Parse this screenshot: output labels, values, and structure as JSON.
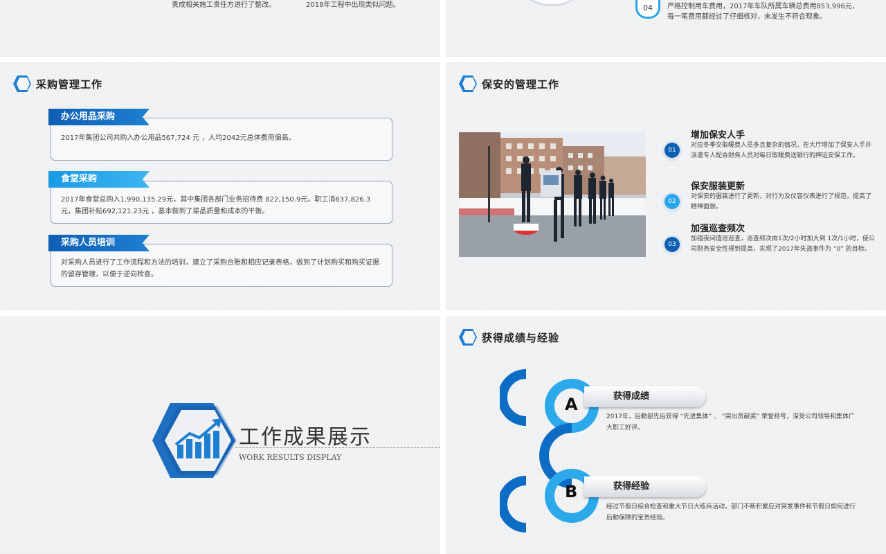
{
  "top_left": {
    "text_a": "责成相关施工责任方进行了整改。",
    "text_b": "2018年工程中出现类似问题。"
  },
  "top_right": {
    "num": "04",
    "line1": "严格控制用车费用，2017年车队所属车辆总费用853,996元，",
    "line2": "每一笔费用都经过了仔细核对，未发生不符合现象。"
  },
  "procurement": {
    "title": "采购管理工作",
    "items": [
      {
        "label": "办公用品采购",
        "text": "2017年集团公司共购入办公用品567,724  元 ，人均2042元总体费用偏高。"
      },
      {
        "label": "食堂采购",
        "text": "2017年食堂总购入1,990,135.29元，其中集团各部门业务招待费 822,150.9元。职工消637,826.3元，集团补贴692,121.23元  ，基本做到了菜品质量和成本的平衡。"
      },
      {
        "label": "采购人员培训",
        "text": "对采购人员进行了工作流程和方法的培训，建立了采购台账和相应记录表格，做到了计划购买和购买证据的留存管理，以便于逆向检查。"
      }
    ]
  },
  "security": {
    "title": "保安的管理工作",
    "items": [
      {
        "num": "01",
        "head": "增加保安人手",
        "body": "对应冬季交取暖费人员多且复杂的情况，在大厅增加了保安人手并派遣专人配合财务人员对每日取暖费送银行的押运安保工作。"
      },
      {
        "num": "02",
        "head": "保安服装更新",
        "body": "对保安的服装进行了更新，对行为及仪容仪表进行了规范，提高了精神面貌。"
      },
      {
        "num": "03",
        "head": "加强巡查频次",
        "body": "加强夜间值班巡查，巡查频次由1次/2小时加大到 1次/1小时，使公司财务安全性得到提高，实现了2017年失盗事件为 “0” 的目标。"
      }
    ]
  },
  "cover": {
    "title": "工作成果展示",
    "subtitle": "WORK RESULTS DISPLAY"
  },
  "results": {
    "title": "获得成绩与经验",
    "items": [
      {
        "letter": "A",
        "label": "获得成绩",
        "text": "2017年，后勤部先后获得 “先进集体” 、 “突出贡献奖” 荣誉称号，深受公司领导和集体广大职工好评。"
      },
      {
        "letter": "B",
        "label": "获得经验",
        "text": "经过节假日综合检查和重大节日大练兵活动，部门不断积累应对突发事件和节假日如何进行后勤保障的宝贵经验。"
      }
    ]
  },
  "colors": {
    "dark_blue": "#0d5fb3",
    "light_blue": "#29a6ea"
  }
}
